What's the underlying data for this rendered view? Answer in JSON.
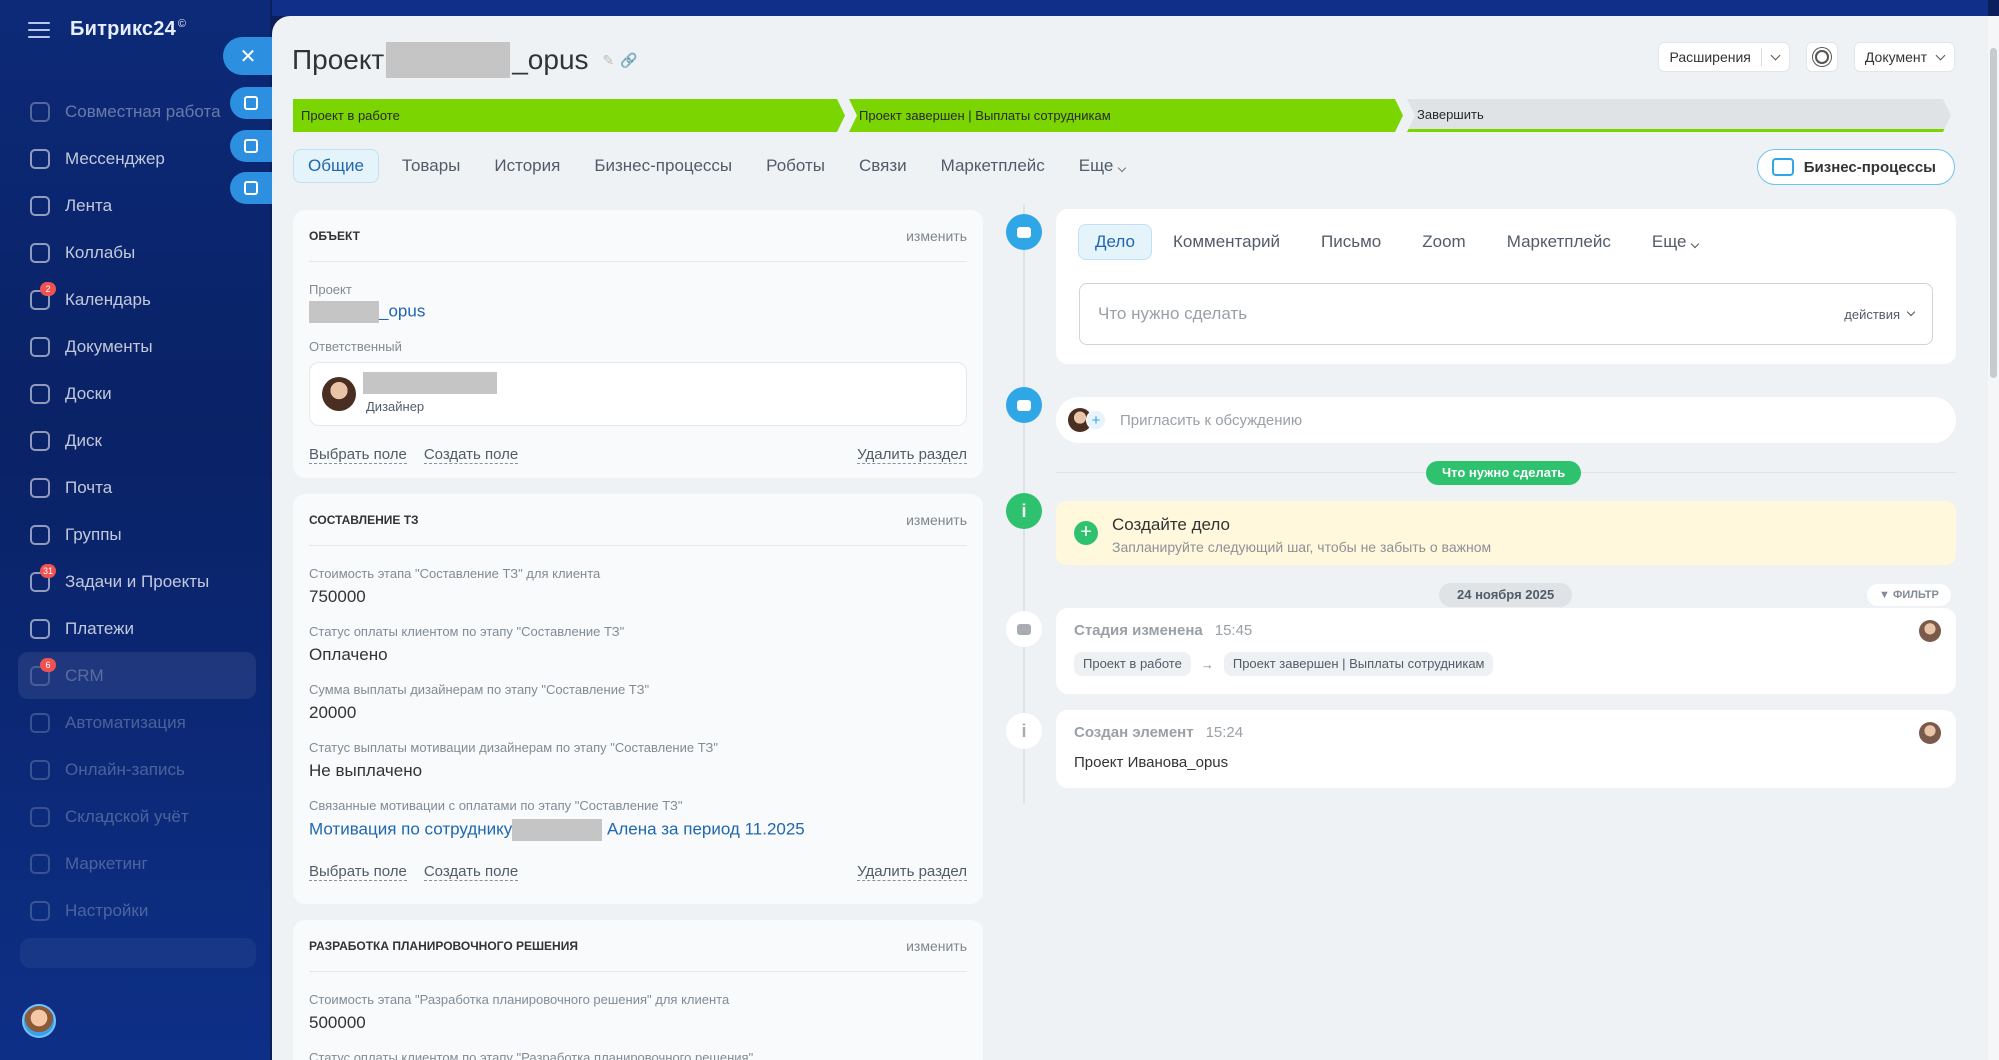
{
  "sidebar": {
    "logo": "Битрикс24",
    "logo_mark": "©",
    "items": [
      {
        "label": "Совместная работа",
        "badge": ""
      },
      {
        "label": "Мессенджер",
        "badge": ""
      },
      {
        "label": "Лента",
        "badge": ""
      },
      {
        "label": "Коллабы",
        "badge": ""
      },
      {
        "label": "Календарь",
        "badge": "2"
      },
      {
        "label": "Документы",
        "badge": ""
      },
      {
        "label": "Доски",
        "badge": ""
      },
      {
        "label": "Диск",
        "badge": ""
      },
      {
        "label": "Почта",
        "badge": ""
      },
      {
        "label": "Группы",
        "badge": ""
      },
      {
        "label": "Задачи и Проекты",
        "badge": "31"
      },
      {
        "label": "Платежи",
        "badge": ""
      },
      {
        "label": "CRM",
        "badge": "6"
      },
      {
        "label": "Автоматизация",
        "badge": ""
      },
      {
        "label": "Онлайн-запись",
        "badge": ""
      },
      {
        "label": "Складской учёт",
        "badge": ""
      },
      {
        "label": "Маркетинг",
        "badge": ""
      },
      {
        "label": "Настройки",
        "badge": ""
      }
    ]
  },
  "header": {
    "title_prefix": "Проект",
    "title_suffix": "_opus",
    "extensions_label": "Расширения",
    "document_label": "Документ"
  },
  "stages": [
    {
      "label": "Проект в работе",
      "state": "done"
    },
    {
      "label": "Проект завершен | Выплаты сотрудникам",
      "state": "done"
    },
    {
      "label": "Завершить",
      "state": "pending"
    }
  ],
  "tabs": [
    "Общие",
    "Товары",
    "История",
    "Бизнес-процессы",
    "Роботы",
    "Связи",
    "Маркетплейс",
    "Еще"
  ],
  "bp_button": "Бизнес-процессы",
  "card_common": {
    "edit": "изменить",
    "select_field": "Выбрать поле",
    "create_field": "Создать поле",
    "delete_section": "Удалить раздел"
  },
  "card_object": {
    "title": "ОБЪЕКТ",
    "project_label": "Проект",
    "project_value_suffix": "_opus",
    "responsible_label": "Ответственный",
    "responsible_role": "Дизайнер"
  },
  "card_tz": {
    "title": "СОСТАВЛЕНИЕ ТЗ",
    "fields": [
      {
        "label": "Стоимость этапа \"Составление ТЗ\" для клиента",
        "value": "750000"
      },
      {
        "label": "Статус оплаты клиентом по этапу \"Составление ТЗ\"",
        "value": "Оплачено"
      },
      {
        "label": "Сумма выплаты дизайнерам по этапу \"Составление ТЗ\"",
        "value": "20000"
      },
      {
        "label": "Статус выплаты мотивации дизайнерам по этапу \"Составление ТЗ\"",
        "value": "Не выплачено"
      }
    ],
    "link_label": "Связанные мотивации с оплатами по этапу \"Составление ТЗ\"",
    "link_prefix": "Мотивация по сотруднику",
    "link_suffix": "Алена за период 11.2025"
  },
  "card_plan": {
    "title": "РАЗРАБОТКА ПЛАНИРОВОЧНОГО РЕШЕНИЯ",
    "fields": [
      {
        "label": "Стоимость этапа \"Разработка планировочного решения\" для клиента",
        "value": "500000"
      },
      {
        "label": "Статус оплаты клиентом по этапу \"Разработка планировочного решения\"",
        "value": ""
      }
    ]
  },
  "activity": {
    "tabs": [
      "Дело",
      "Комментарий",
      "Письмо",
      "Zoom",
      "Маркетплейс",
      "Еще"
    ],
    "placeholder": "Что нужно сделать",
    "actions": "действия"
  },
  "invite_text": "Пригласить к обсуждению",
  "todo_pill": "Что нужно сделать",
  "create_task": {
    "title": "Создайте дело",
    "subtitle": "Запланируйте следующий шаг, чтобы не забыть о важном"
  },
  "date_label": "24 ноября 2025",
  "filter_label": "ФИЛЬТР",
  "events": [
    {
      "title": "Стадия изменена",
      "time": "15:45",
      "from": "Проект в работе",
      "to": "Проект завершен | Выплаты сотрудникам"
    },
    {
      "title": "Создан элемент",
      "time": "15:24",
      "text": "Проект Иванова_opus"
    }
  ],
  "colors": {
    "stage_green": "#7bd500",
    "accent_blue": "#2fa6e6",
    "success_green": "#2fc26e"
  }
}
